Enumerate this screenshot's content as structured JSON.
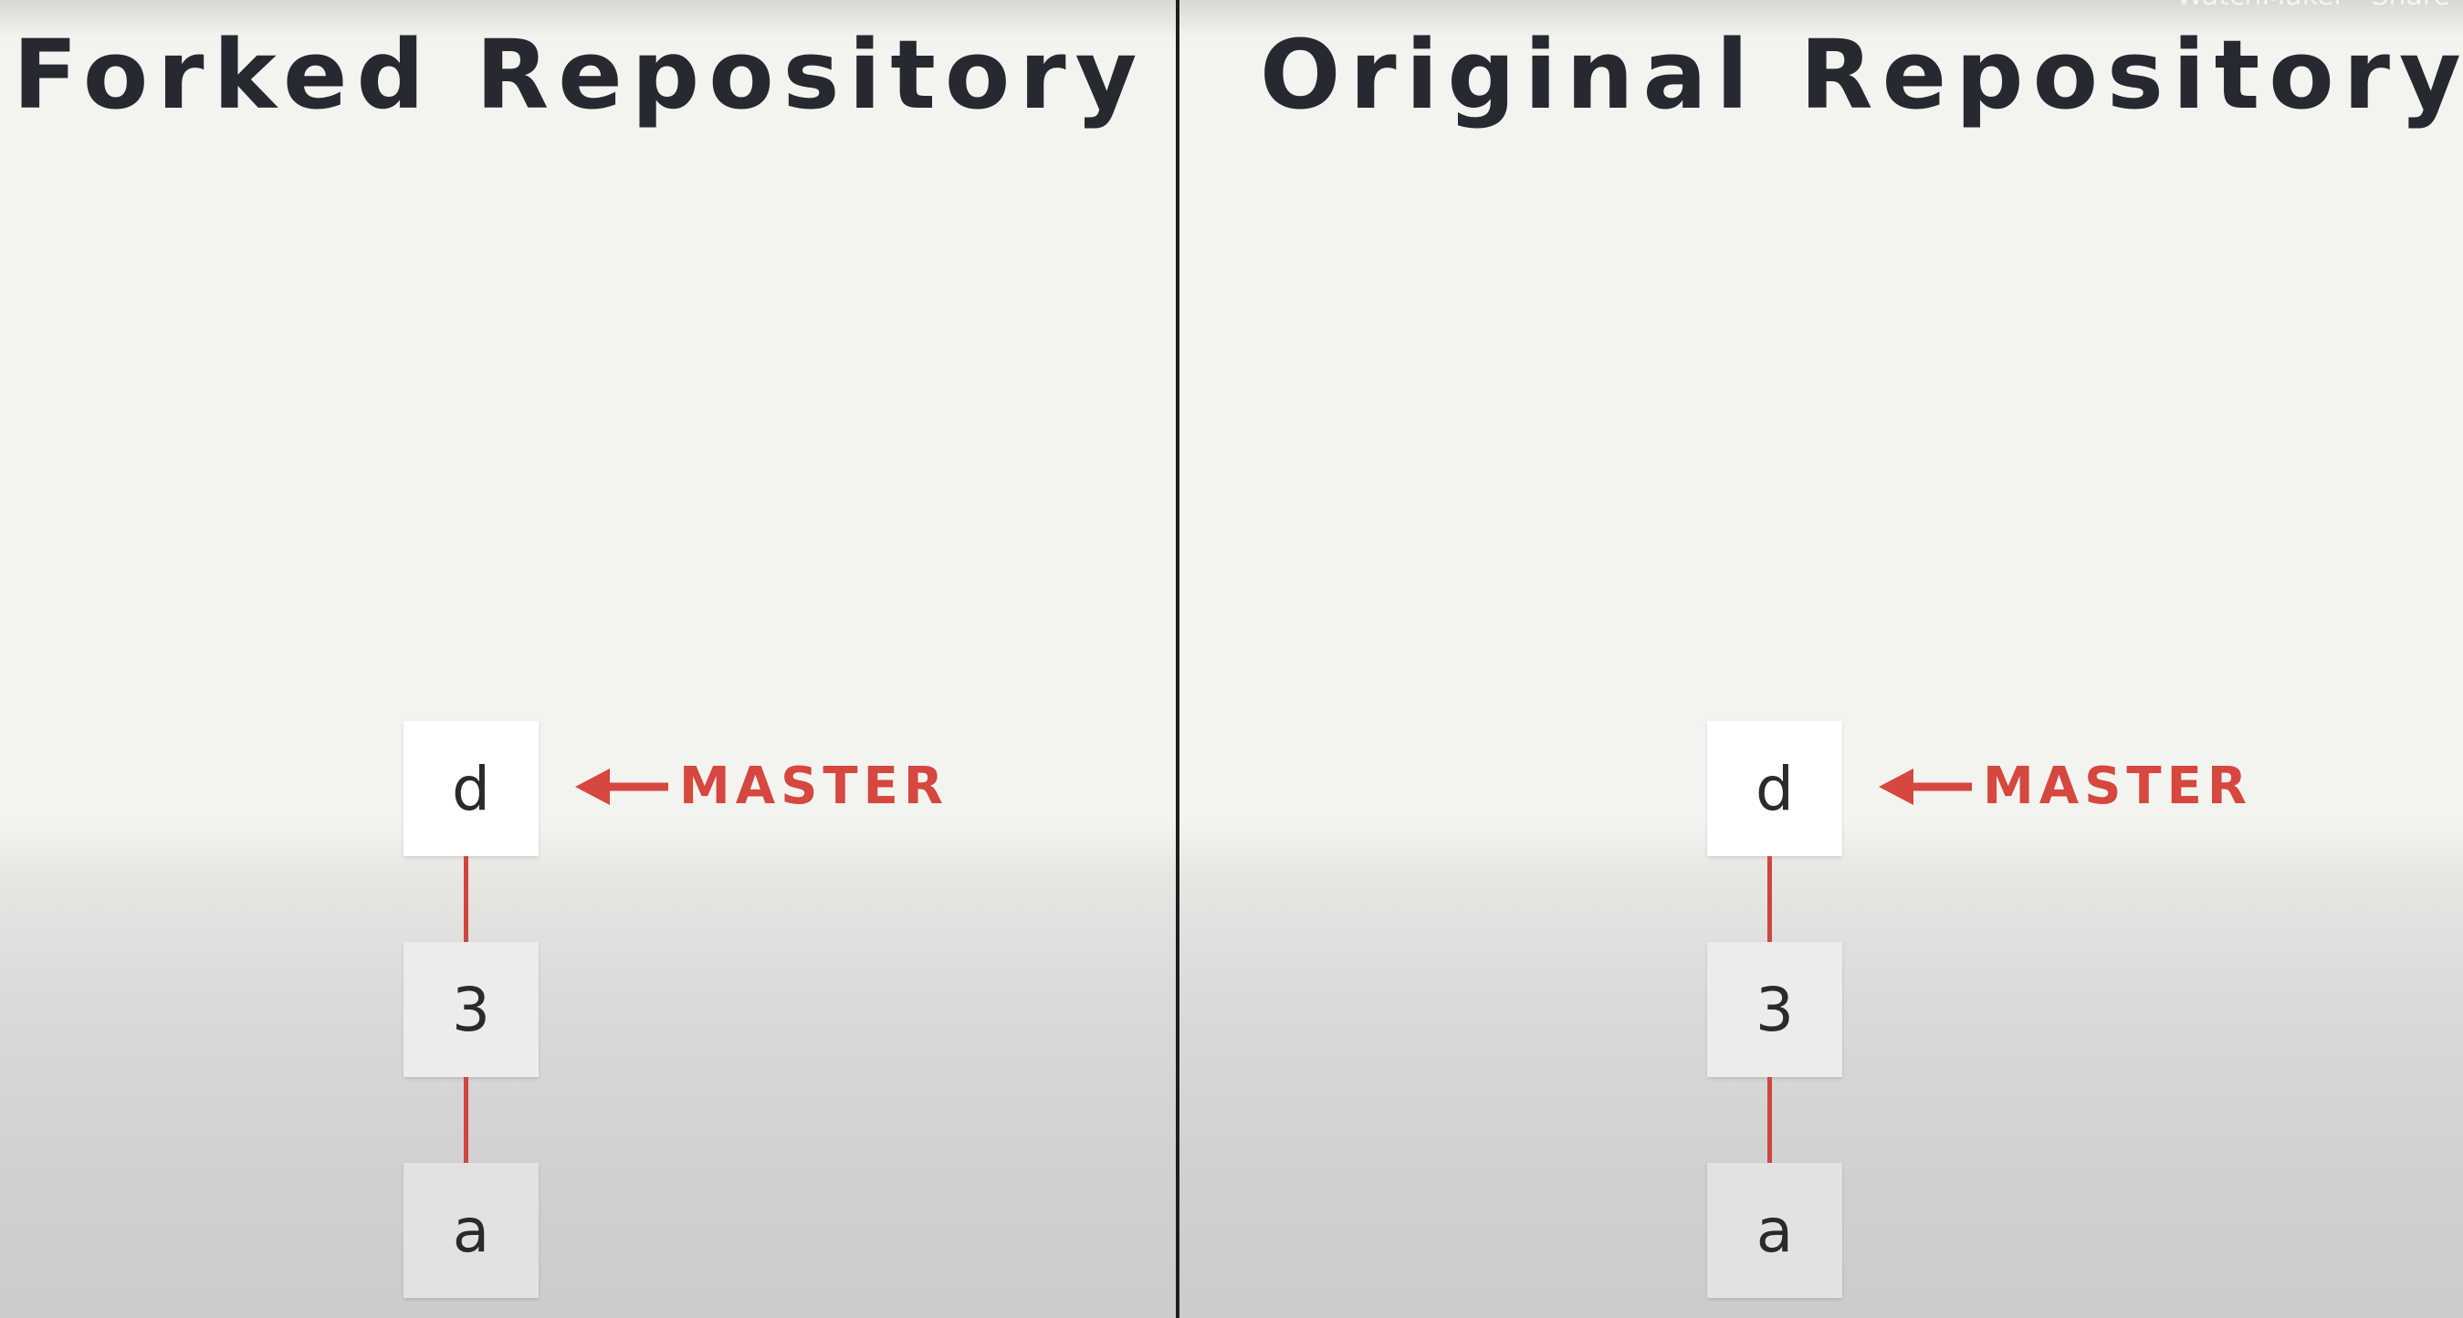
{
  "watermark": "WatchMaker · Share",
  "colors": {
    "branch_line": "#cf4540",
    "pointer": "#d5473f",
    "title": "#262a30",
    "divider": "#1e1e1e"
  },
  "panels": [
    {
      "title": "Forked Repository",
      "commits": [
        "d",
        "3",
        "a"
      ],
      "branch_pointer": {
        "label": "MASTER",
        "icon": "arrow-left-icon"
      }
    },
    {
      "title": "Original Repository",
      "commits": [
        "d",
        "3",
        "a"
      ],
      "branch_pointer": {
        "label": "MASTER",
        "icon": "arrow-left-icon"
      }
    }
  ]
}
